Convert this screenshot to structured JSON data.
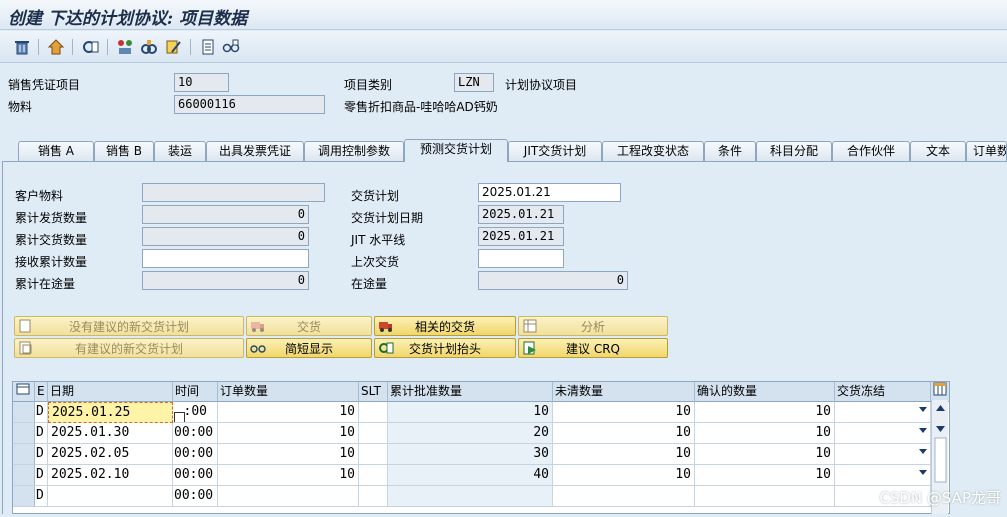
{
  "window": {
    "title": "创建 下达的计划协议: 项目数据"
  },
  "toolbar": {
    "icons": [
      "delete-icon",
      "other-item-icon",
      "display-doc-icon",
      "copy-icon",
      "config-icon",
      "edit-icon",
      "notes-icon",
      "glasses-icon"
    ]
  },
  "header": {
    "sales_item_label": "销售凭证项目",
    "sales_item_value": "10",
    "item_category_label": "项目类别",
    "item_category_value": "LZN",
    "item_category_desc": "计划协议项目",
    "material_label": "物料",
    "material_value": "66000116",
    "material_desc": "零售折扣商品-哇哈哈AD钙奶"
  },
  "tabs": [
    {
      "label": "销售 A"
    },
    {
      "label": "销售 B"
    },
    {
      "label": "装运"
    },
    {
      "label": "出具发票凭证"
    },
    {
      "label": "调用控制参数"
    },
    {
      "label": "预测交货计划",
      "active": true
    },
    {
      "label": "JIT交货计划"
    },
    {
      "label": "工程改变状态"
    },
    {
      "label": "条件"
    },
    {
      "label": "科目分配"
    },
    {
      "label": "合作伙伴"
    },
    {
      "label": "文本"
    },
    {
      "label": "订单数据"
    }
  ],
  "form": {
    "customer_material_label": "客户物料",
    "customer_material_value": "",
    "cum_issued_label": "累计发货数量",
    "cum_issued_value": "0",
    "cum_delivered_label": "累计交货数量",
    "cum_delivered_value": "0",
    "cum_received_label": "接收累计数量",
    "cum_received_value": "",
    "cum_in_transit_label": "累计在途量",
    "cum_in_transit_value": "0",
    "delivery_schedule_label": "交货计划",
    "delivery_schedule_value": "2025.01.21",
    "schedule_date_label": "交货计划日期",
    "schedule_date_value": "2025.01.21",
    "jit_horizon_label": "JIT 水平线",
    "jit_horizon_value": "2025.01.21",
    "last_delivery_label": "上次交货",
    "last_delivery_value": "",
    "in_transit_label": "在途量",
    "in_transit_value": "0"
  },
  "buttons": {
    "new_no_proposal": "没有建议的新交货计划",
    "new_with_proposal": "有建议的新交货计划",
    "delivery": "交货",
    "short_display": "简短显示",
    "related_delivery": "相关的交货",
    "schedule_header": "交货计划抬头",
    "analysis": "分析",
    "propose_crq": "建议 CRQ"
  },
  "table": {
    "columns": [
      "E",
      "日期",
      "时间",
      "订单数量",
      "SLT",
      "累计批准数量",
      "未清数量",
      "确认的数量",
      "交货冻结"
    ],
    "rows": [
      {
        "e": "D",
        "date": "2025.01.25",
        "time": "00:00",
        "qty": "10",
        "slt": "",
        "cum": "10",
        "open": "10",
        "conf": "10"
      },
      {
        "e": "D",
        "date": "2025.01.30",
        "time": "00:00",
        "qty": "10",
        "slt": "",
        "cum": "20",
        "open": "10",
        "conf": "10"
      },
      {
        "e": "D",
        "date": "2025.02.05",
        "time": "00:00",
        "qty": "10",
        "slt": "",
        "cum": "30",
        "open": "10",
        "conf": "10"
      },
      {
        "e": "D",
        "date": "2025.02.10",
        "time": "00:00",
        "qty": "10",
        "slt": "",
        "cum": "40",
        "open": "10",
        "conf": "10"
      },
      {
        "e": "D",
        "date": "",
        "time": "00:00",
        "qty": "",
        "slt": "",
        "cum": "",
        "open": "",
        "conf": ""
      }
    ]
  },
  "watermark": "CSDN @SAP龙哥"
}
